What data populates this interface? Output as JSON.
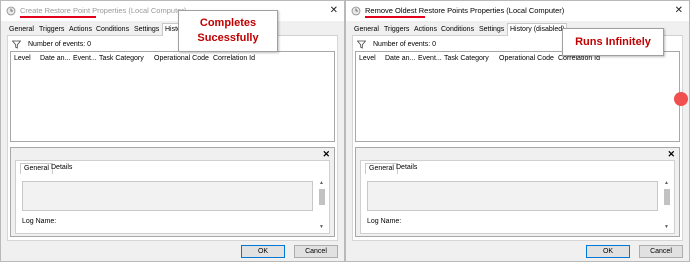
{
  "left_dialog": {
    "title": "Create Restore Point Properties (Local Computer)",
    "tabs": [
      "General",
      "Triggers",
      "Actions",
      "Conditions",
      "Settings",
      "History"
    ],
    "active_tab_index": 5,
    "events_label": "Number of events: 0",
    "columns": [
      "Level",
      "Date an...",
      "Event...",
      "Task Category",
      "Operational Code",
      "Correlation Id"
    ],
    "detail_tabs": [
      "General",
      "Details"
    ],
    "log_name_label": "Log Name:",
    "ok_label": "OK",
    "cancel_label": "Cancel",
    "callout": [
      "Completes",
      "Sucessfully"
    ]
  },
  "right_dialog": {
    "title": "Remove Oldest Restore Points Properties (Local Computer)",
    "tabs": [
      "General",
      "Triggers",
      "Actions",
      "Conditions",
      "Settings",
      "History (disabled)"
    ],
    "active_tab_index": 5,
    "events_label": "Number of events: 0",
    "columns": [
      "Level",
      "Date an...",
      "Event...",
      "Task Category",
      "Operational Code",
      "Correlation Id"
    ],
    "detail_tabs": [
      "General",
      "Details"
    ],
    "log_name_label": "Log Name:",
    "ok_label": "OK",
    "cancel_label": "Cancel",
    "callout": [
      "Runs Infinitely"
    ]
  },
  "colors": {
    "annotation_red": "#c00000",
    "underline_red": "#e3001b",
    "marker": "#f05050"
  }
}
